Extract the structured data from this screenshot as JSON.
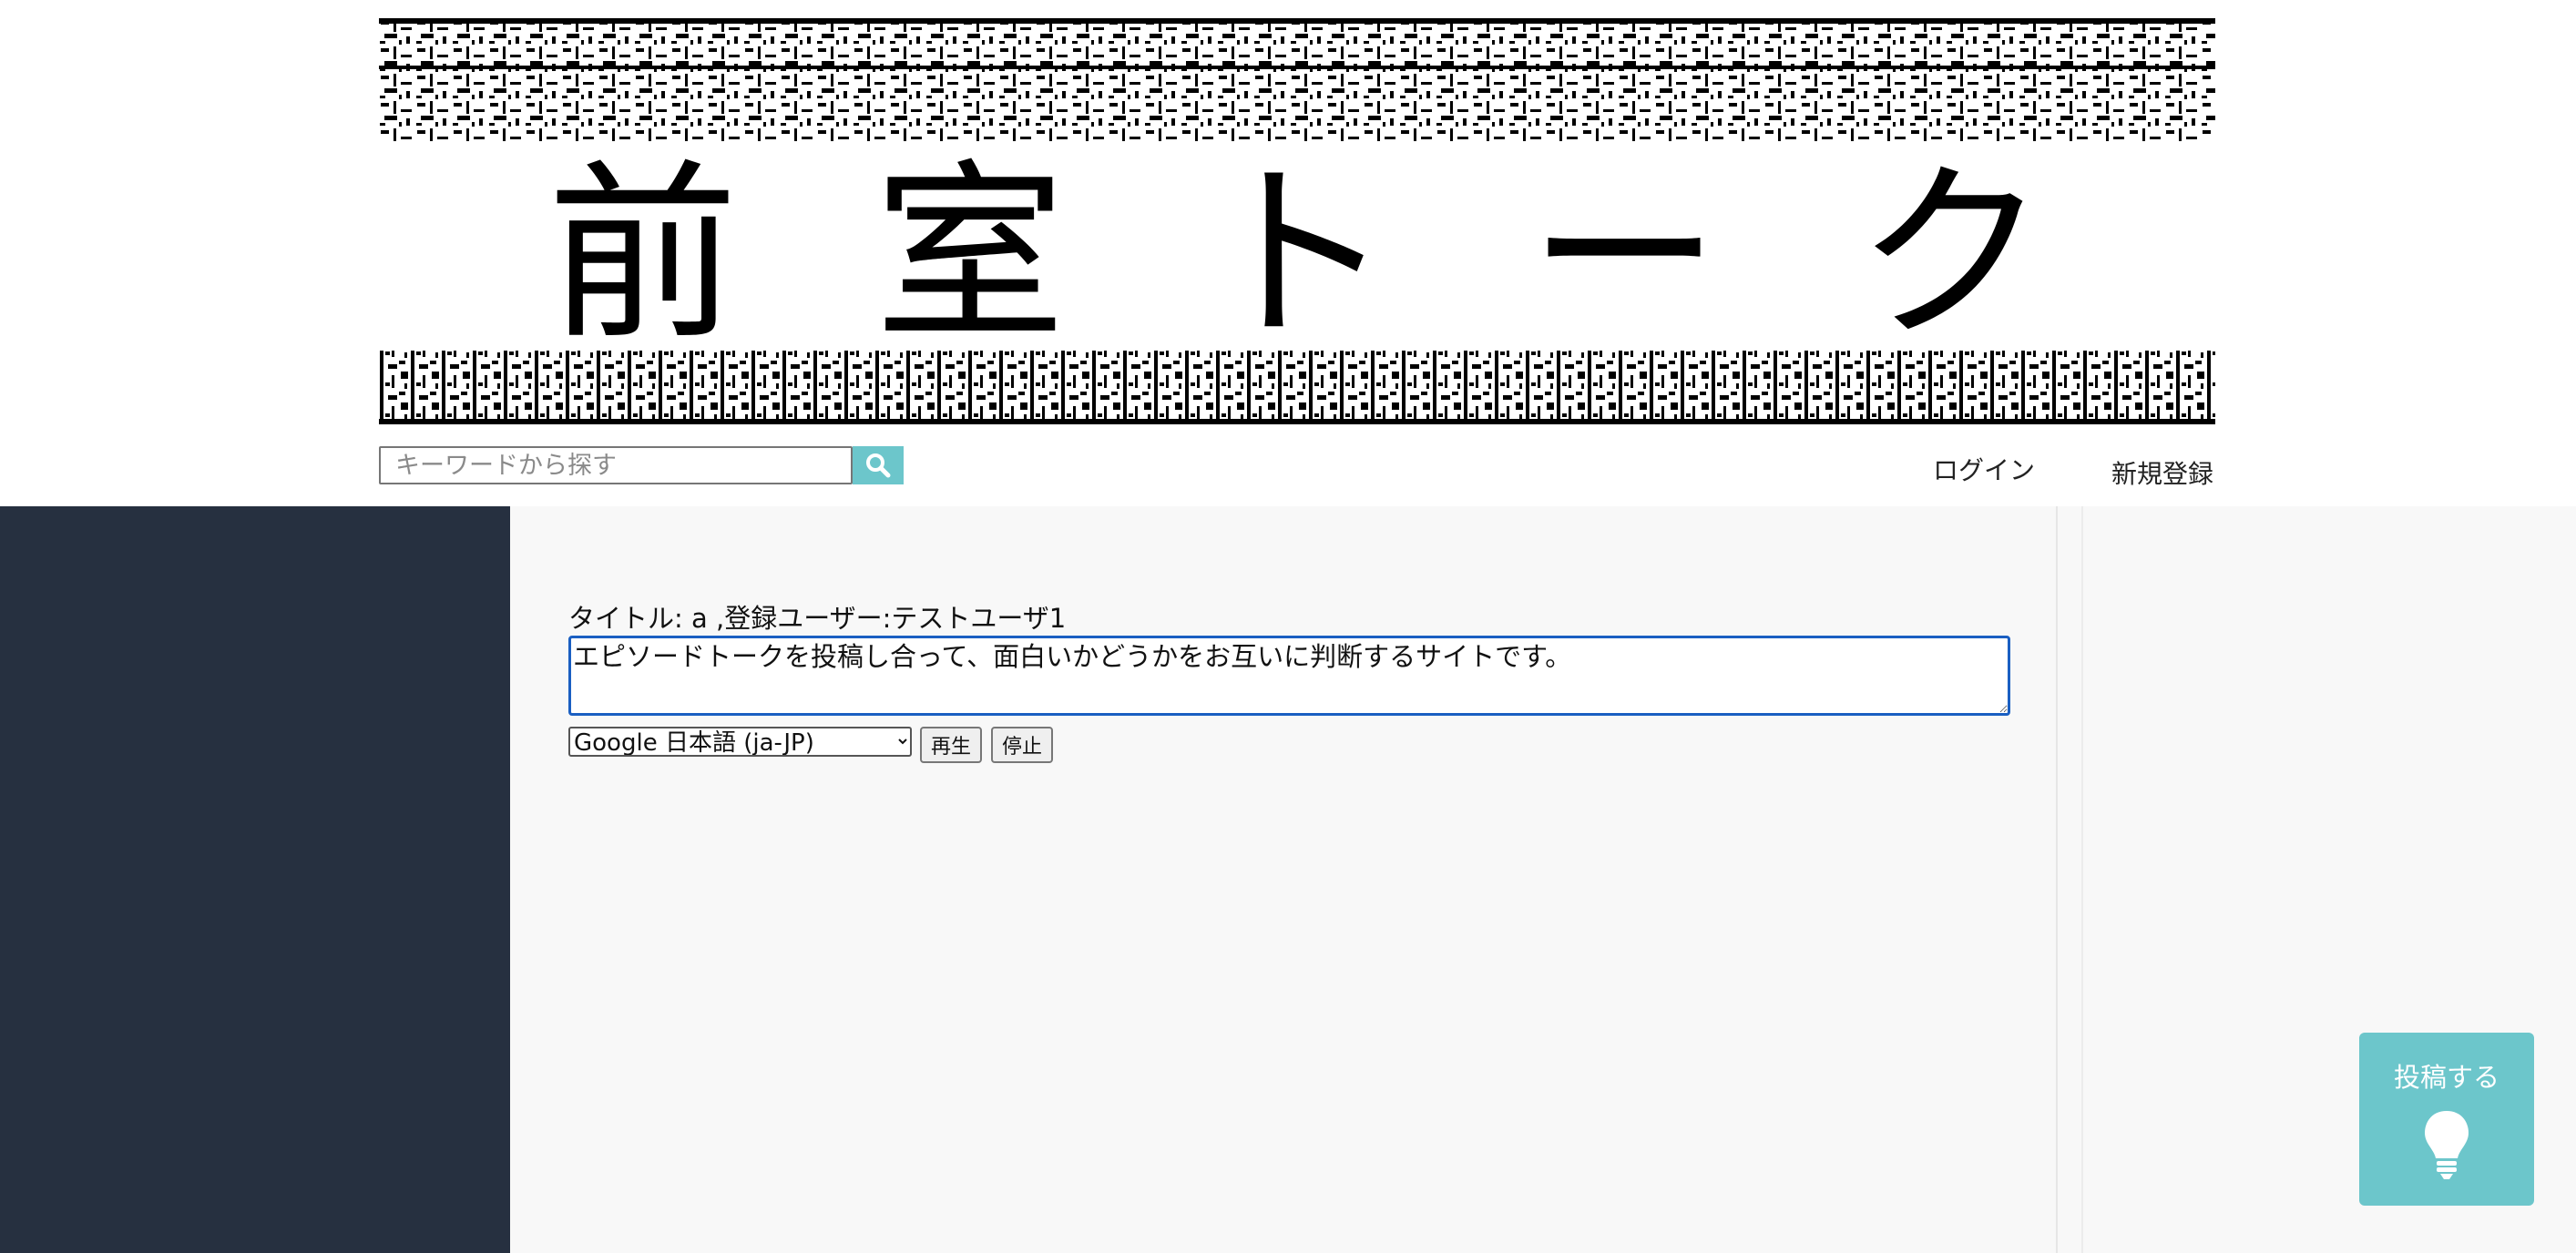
{
  "header": {
    "banner_title_chars": [
      "前",
      "室",
      "ト",
      "ー",
      "ク"
    ],
    "search_placeholder": "キーワードから探す",
    "search_icon": "search-icon",
    "login_label": "ログイン",
    "signup_label": "新規登録"
  },
  "post": {
    "meta": "タイトル: a ,登録ユーザー:テストユーザ1",
    "text": "エピソードトークを投稿し合って、面白いかどうかをお互いに判断するサイトです。",
    "voice_selected": "Google 日本語 (ja-JP)",
    "play_label": "再生",
    "stop_label": "停止"
  },
  "fab": {
    "label": "投稿する",
    "icon": "lightbulb-icon"
  },
  "colors": {
    "sidebar": "#263040",
    "accent": "#6cc6cb",
    "main_bg": "#f8f8f8",
    "textarea_border": "#1a5fc2"
  }
}
